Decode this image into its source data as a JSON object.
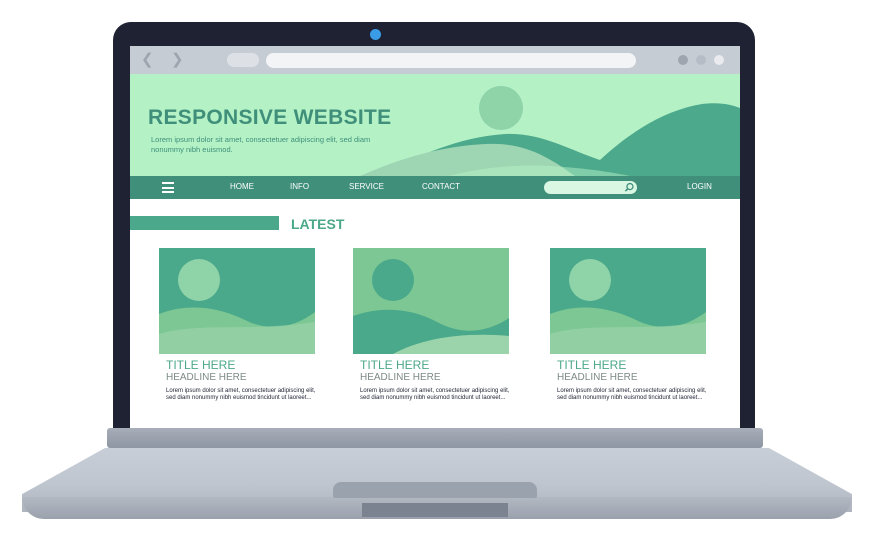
{
  "browser": {
    "back_icon": "chevron-left-icon",
    "forward_icon": "chevron-right-icon",
    "window_dots": [
      "#9ea5af",
      "#b6bcc5",
      "#e9ebee"
    ]
  },
  "hero": {
    "title": "RESPONSIVE WEBSITE",
    "subtitle": "Lorem ipsum dolor sit amet, consectetuer adipiscing elit, sed diam nonummy nibh euismod."
  },
  "nav": {
    "menu_icon": "hamburger-menu-icon",
    "links": [
      "HOME",
      "INFO",
      "SERVICE",
      "CONTACT"
    ],
    "search_placeholder": "",
    "login": "LOGIN"
  },
  "latest": {
    "label": "LATEST"
  },
  "cards": [
    {
      "title": "TITLE HERE",
      "headline": "HEADLINE HERE",
      "body": "Lorem ipsum dolor sit amet, consectetuer adipiscing elit, sed diam nonummy nibh euismod tincidunt ut laoreet..."
    },
    {
      "title": "TITLE HERE",
      "headline": "HEADLINE HERE",
      "body": "Lorem ipsum dolor sit amet, consectetuer adipiscing elit, sed diam nonummy nibh euismod tincidunt ut laoreet..."
    },
    {
      "title": "TITLE HERE",
      "headline": "HEADLINE HERE",
      "body": "Lorem ipsum dolor sit amet, consectetuer adipiscing elit, sed diam nonummy nibh euismod tincidunt ut laoreet..."
    }
  ],
  "colors": {
    "hero_bg": "#b4f2c6",
    "dark_green": "#3f8f7a",
    "accent_green": "#4ca88a",
    "bezel": "#1e2233",
    "camera": "#3a9be6"
  }
}
